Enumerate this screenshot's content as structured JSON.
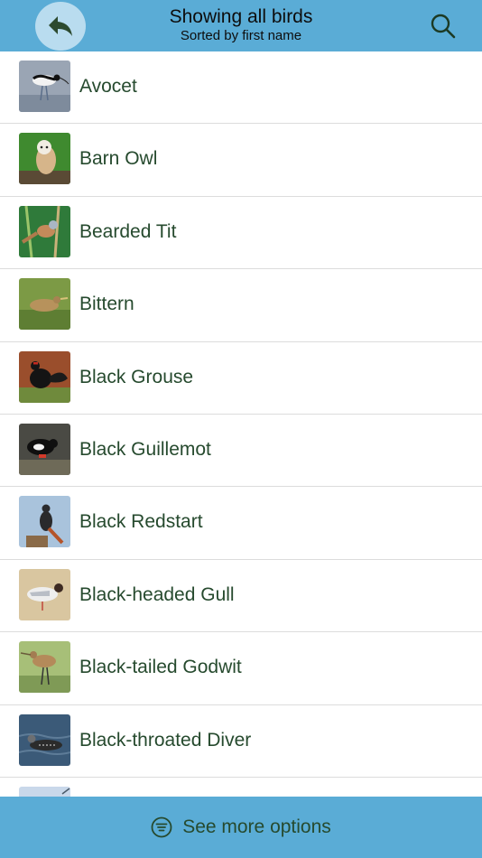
{
  "header": {
    "title": "Showing all birds",
    "subtitle": "Sorted by first name",
    "back_icon": "reply-arrow-icon",
    "search_icon": "search-icon"
  },
  "birds": [
    {
      "name": "Avocet"
    },
    {
      "name": "Barn Owl"
    },
    {
      "name": "Bearded Tit"
    },
    {
      "name": "Bittern"
    },
    {
      "name": "Black Grouse"
    },
    {
      "name": "Black Guillemot"
    },
    {
      "name": "Black Redstart"
    },
    {
      "name": "Black-headed Gull"
    },
    {
      "name": "Black-tailed Godwit"
    },
    {
      "name": "Black-throated Diver"
    }
  ],
  "footer": {
    "label": "See more options",
    "icon": "filter-menu-icon"
  },
  "colors": {
    "header_bg": "#5aacd6",
    "text_green": "#264a2e",
    "back_button_bg": "#b9dcef"
  }
}
